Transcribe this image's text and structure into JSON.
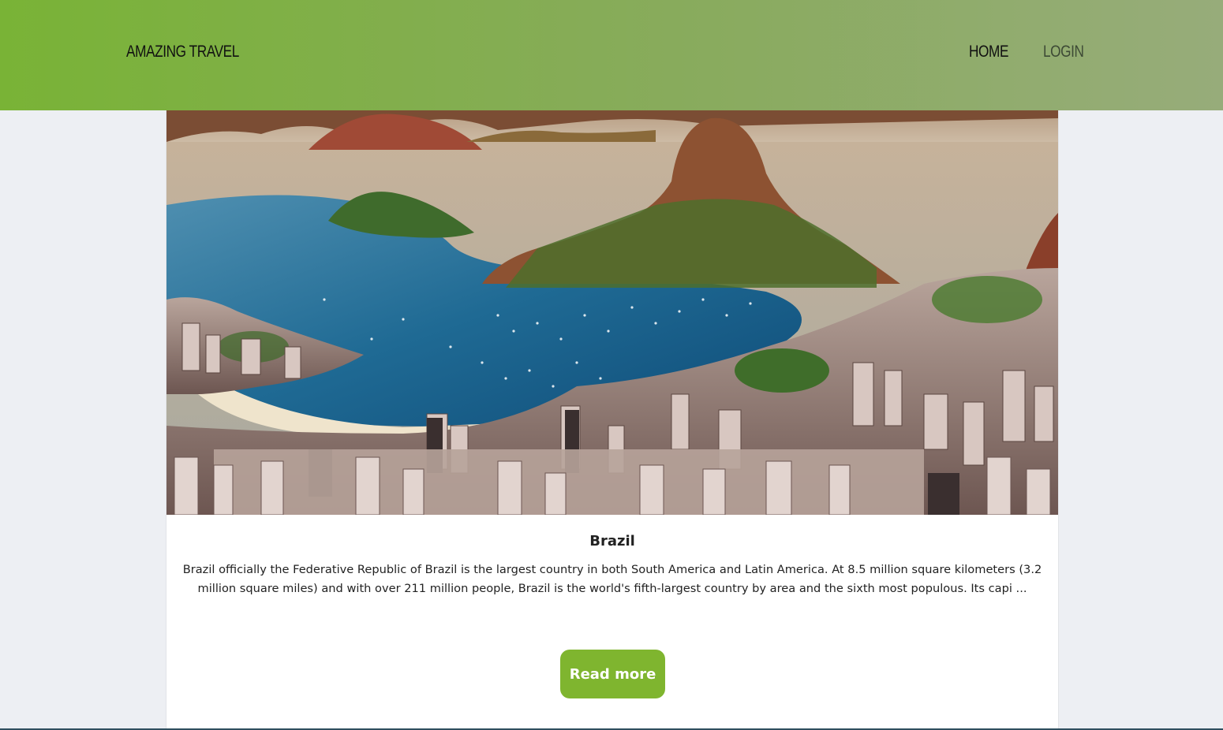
{
  "navbar": {
    "brand": "AMAZING TRAVEL",
    "links": [
      {
        "label": "HOME"
      },
      {
        "label": "LOGIN"
      }
    ]
  },
  "card": {
    "image_alt": "Rio de Janeiro bay view",
    "title": "Brazil",
    "description": "Brazil officially the Federative Republic of Brazil is the largest country in both South America and Latin America. At 8.5 million square kilometers (3.2 million square miles) and with over 211 million people, Brazil is the world's fifth-largest country by area and the sixth most populous. Its capi ...",
    "button_label": "Read more"
  },
  "colors": {
    "navbar_start": "#79b336",
    "navbar_end": "#97ac7a",
    "button": "#7fb52f",
    "background": "#edeff3"
  }
}
